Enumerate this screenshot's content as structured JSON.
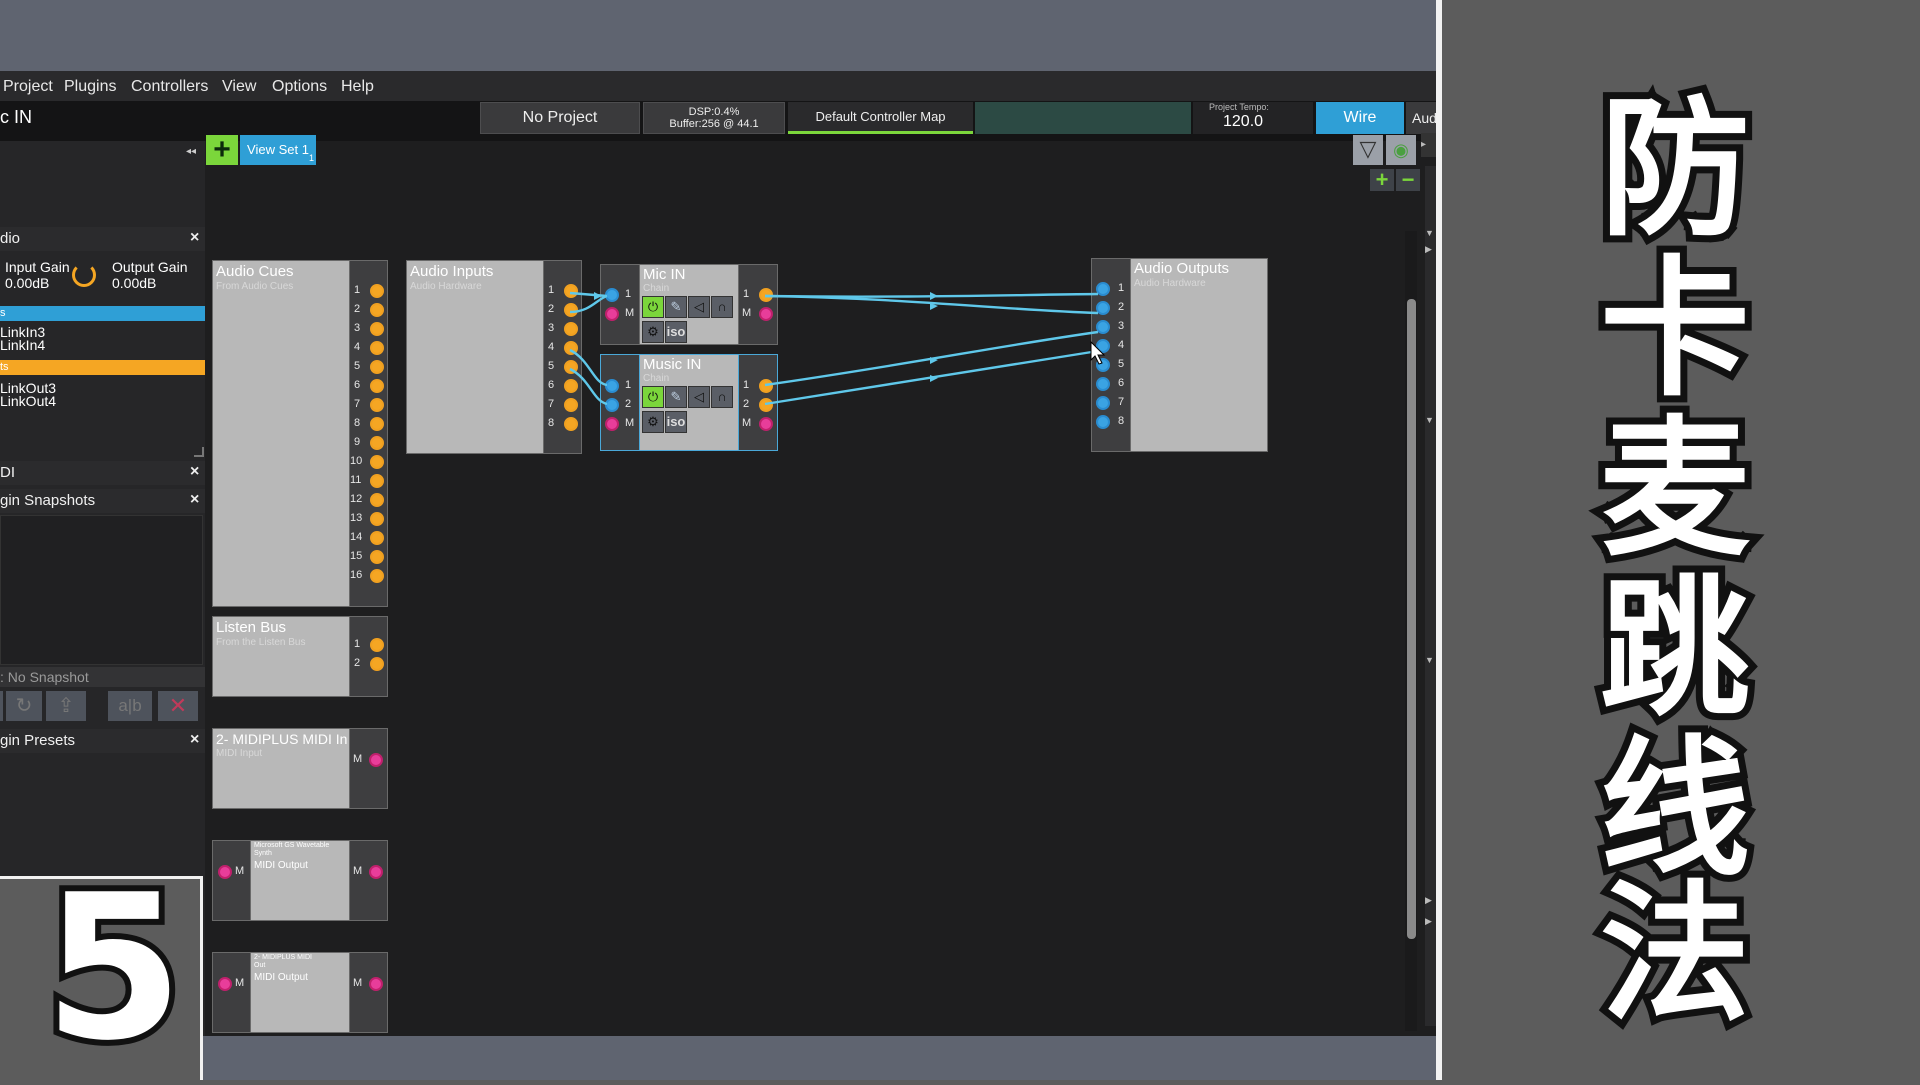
{
  "menu": [
    "Project",
    "Plugins",
    "Controllers",
    "View",
    "Options",
    "Help"
  ],
  "header": {
    "window_title": "c IN",
    "project": "No Project",
    "dsp": "DSP:0.4%",
    "buffer": "Buffer:256 @ 44.1",
    "controller_map": "Default Controller Map",
    "tempo_label": "Project Tempo:",
    "tempo_value": "120.0",
    "wire_label": "Wire",
    "aud_label": "Aud"
  },
  "viewset": {
    "add_icon": "+",
    "name": "View Set 1",
    "number": "1"
  },
  "sidebar": {
    "collapse_icon": "◂◂",
    "audio_header": "dio",
    "input_gain_label": "Input Gain",
    "input_gain_value": "0.00dB",
    "output_gain_label": "Output Gain",
    "output_gain_value": "0.00dB",
    "inputs_row": "s",
    "inputs_items": [
      "LinkIn3",
      "LinkIn4"
    ],
    "outputs_row": "ts",
    "outputs_items": [
      "LinkOut3",
      "LinkOut4"
    ],
    "midi_header": "DI",
    "snapshots_header": "gin Snapshots",
    "snapshot_status": ": No Snapshot",
    "presets_header": "gin Presets",
    "close_icon": "×"
  },
  "canvas": {
    "audio_cues": {
      "title": "Audio Cues",
      "subtitle": "From Audio Cues",
      "ports": [
        "1",
        "2",
        "3",
        "4",
        "5",
        "6",
        "7",
        "8",
        "9",
        "10",
        "11",
        "12",
        "13",
        "14",
        "15",
        "16"
      ]
    },
    "listen_bus": {
      "title": "Listen Bus",
      "subtitle": "From the Listen Bus",
      "ports": [
        "1",
        "2"
      ]
    },
    "midi_in": {
      "title": "2- MIDIPLUS MIDI In",
      "subtitle": "MIDI Input",
      "port": "M"
    },
    "midi_out_gs": {
      "device": "Microsoft GS Wavetable Synth",
      "subtitle": "MIDI Output",
      "port": "M"
    },
    "midi_out_plus": {
      "device": "2- MIDIPLUS MIDI Out",
      "subtitle": "MIDI Output",
      "port": "M"
    },
    "audio_inputs": {
      "title": "Audio Inputs",
      "subtitle": "Audio Hardware",
      "ports": [
        "1",
        "2",
        "3",
        "4",
        "5",
        "6",
        "7",
        "8"
      ]
    },
    "mic_in": {
      "title": "Mic IN",
      "subtitle": "Chain",
      "in_ports": [
        "1",
        "M"
      ],
      "out_ports": [
        "1",
        "M"
      ],
      "iso": "iso"
    },
    "music_in": {
      "title": "Music IN",
      "subtitle": "Chain",
      "in_ports": [
        "1",
        "2",
        "M"
      ],
      "out_ports": [
        "1",
        "2",
        "M"
      ],
      "iso": "iso"
    },
    "audio_outputs": {
      "title": "Audio Outputs",
      "subtitle": "Audio Hardware",
      "ports": [
        "1",
        "2",
        "3",
        "4",
        "5",
        "6",
        "7",
        "8"
      ]
    }
  },
  "overlay": {
    "episode_number": "5",
    "title_chars": [
      "防",
      "卡",
      "麦",
      "跳",
      "线",
      "法"
    ]
  },
  "colors": {
    "wire": "#5fc8ea",
    "port_orange": "#f5a623",
    "port_blue": "#3aa3e3",
    "port_pink": "#e83d9a",
    "accent_blue": "#2f9fd6",
    "accent_green": "#7bd63b"
  }
}
